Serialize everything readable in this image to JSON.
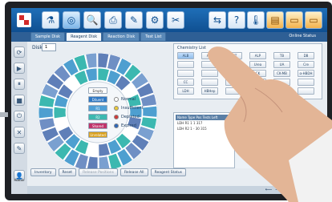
{
  "toolbar": {
    "buttons": [
      {
        "name": "tube-icon",
        "glyph": "⚗"
      },
      {
        "name": "disk-icon",
        "glyph": "◎"
      },
      {
        "name": "search-report-icon",
        "glyph": "🔍"
      },
      {
        "name": "printer-icon",
        "glyph": "⎙"
      },
      {
        "name": "edit-icon",
        "glyph": "✎"
      },
      {
        "name": "settings-icon",
        "glyph": "⚙"
      },
      {
        "name": "tools-icon",
        "glyph": "✂"
      }
    ],
    "right_buttons": [
      {
        "name": "transfer-icon",
        "glyph": "⇆"
      },
      {
        "name": "help-icon",
        "glyph": "?"
      },
      {
        "name": "temperature-icon",
        "glyph": "🌡"
      },
      {
        "name": "cabinet-icon",
        "glyph": "▤"
      },
      {
        "name": "folder-icon",
        "glyph": "▭"
      },
      {
        "name": "folder-open-icon",
        "glyph": "▭"
      }
    ]
  },
  "tabs": [
    "Sample Disk",
    "Reagent Disk",
    "Reaction Disk",
    "Test List"
  ],
  "active_tab": 1,
  "status_online": "Online Status",
  "disk": {
    "label": "Disk",
    "value": "1"
  },
  "legend": {
    "boxes": [
      {
        "label": "Empty",
        "color": "#ffffff",
        "text": "#333333"
      },
      {
        "label": "Diluent",
        "color": "#2f78c4",
        "text": "#ffffff"
      },
      {
        "label": "R1",
        "color": "#4f9fd6",
        "text": "#ffffff"
      },
      {
        "label": "R2",
        "color": "#3cb8b0",
        "text": "#ffffff"
      },
      {
        "label": "Shared",
        "color": "#c0346a",
        "text": "#ffffff"
      },
      {
        "label": "Unrelated",
        "color": "#d9a01c",
        "text": "#ffffff"
      }
    ],
    "states": [
      {
        "label": "Normal",
        "color": "#ffffff"
      },
      {
        "label": "Insufficient",
        "color": "#e8c93c"
      },
      {
        "label": "Depleted",
        "color": "#d03a3a"
      },
      {
        "label": "Expired",
        "color": "#2e67b8"
      }
    ]
  },
  "bottom_buttons": [
    {
      "label": "Inventory",
      "enabled": true
    },
    {
      "label": "Reset",
      "enabled": true
    },
    {
      "label": "Release Positions",
      "enabled": false
    },
    {
      "label": "Release All",
      "enabled": true
    },
    {
      "label": "Reagent Status",
      "enabled": true
    }
  ],
  "chemistry": {
    "title": "Chemistry List",
    "tests": [
      "ALB",
      "ALP",
      "AST",
      "ALP",
      "TB",
      "DB",
      "",
      "",
      "GLU",
      "Urea",
      "UA",
      "Cre",
      "",
      "",
      "",
      "CK",
      "CK-MB",
      "α-HBDH",
      "CC",
      "",
      "",
      "",
      "",
      "",
      "LDH",
      "HBHep",
      "",
      "",
      "",
      ""
    ]
  },
  "results": {
    "header": "Name Type Pos Tests Left",
    "rows": [
      "LDH R1 1 1 317",
      "LDH R2 1 - 30 315"
    ]
  },
  "admin_label": "Admin",
  "status": {
    "icons": "⟵ ⟶ C A V ?",
    "year": "2014"
  }
}
